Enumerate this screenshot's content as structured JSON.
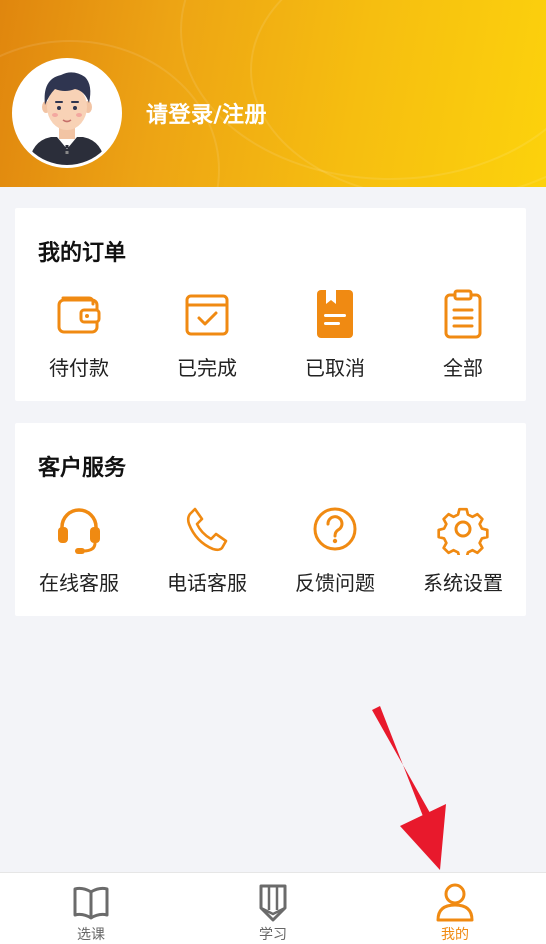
{
  "header": {
    "login_text": "请登录/注册"
  },
  "orders": {
    "title": "我的订单",
    "items": [
      {
        "label": "待付款",
        "icon": "wallet-icon"
      },
      {
        "label": "已完成",
        "icon": "calendar-check-icon"
      },
      {
        "label": "已取消",
        "icon": "bookmark-doc-icon"
      },
      {
        "label": "全部",
        "icon": "clipboard-icon"
      }
    ]
  },
  "service": {
    "title": "客户服务",
    "items": [
      {
        "label": "在线客服",
        "icon": "headset-icon"
      },
      {
        "label": "电话客服",
        "icon": "phone-icon"
      },
      {
        "label": "反馈问题",
        "icon": "question-icon"
      },
      {
        "label": "系统设置",
        "icon": "gear-icon"
      }
    ]
  },
  "tabbar": {
    "items": [
      {
        "label": "选课",
        "icon": "book-icon",
        "active": false
      },
      {
        "label": "学习",
        "icon": "pencil-icon",
        "active": false
      },
      {
        "label": "我的",
        "icon": "user-icon",
        "active": true
      }
    ]
  },
  "colors": {
    "accent": "#f08a12",
    "header_start": "#e0860e",
    "header_end": "#fcd20c",
    "background": "#f3f4f8",
    "annotation_arrow": "#e8192c"
  }
}
